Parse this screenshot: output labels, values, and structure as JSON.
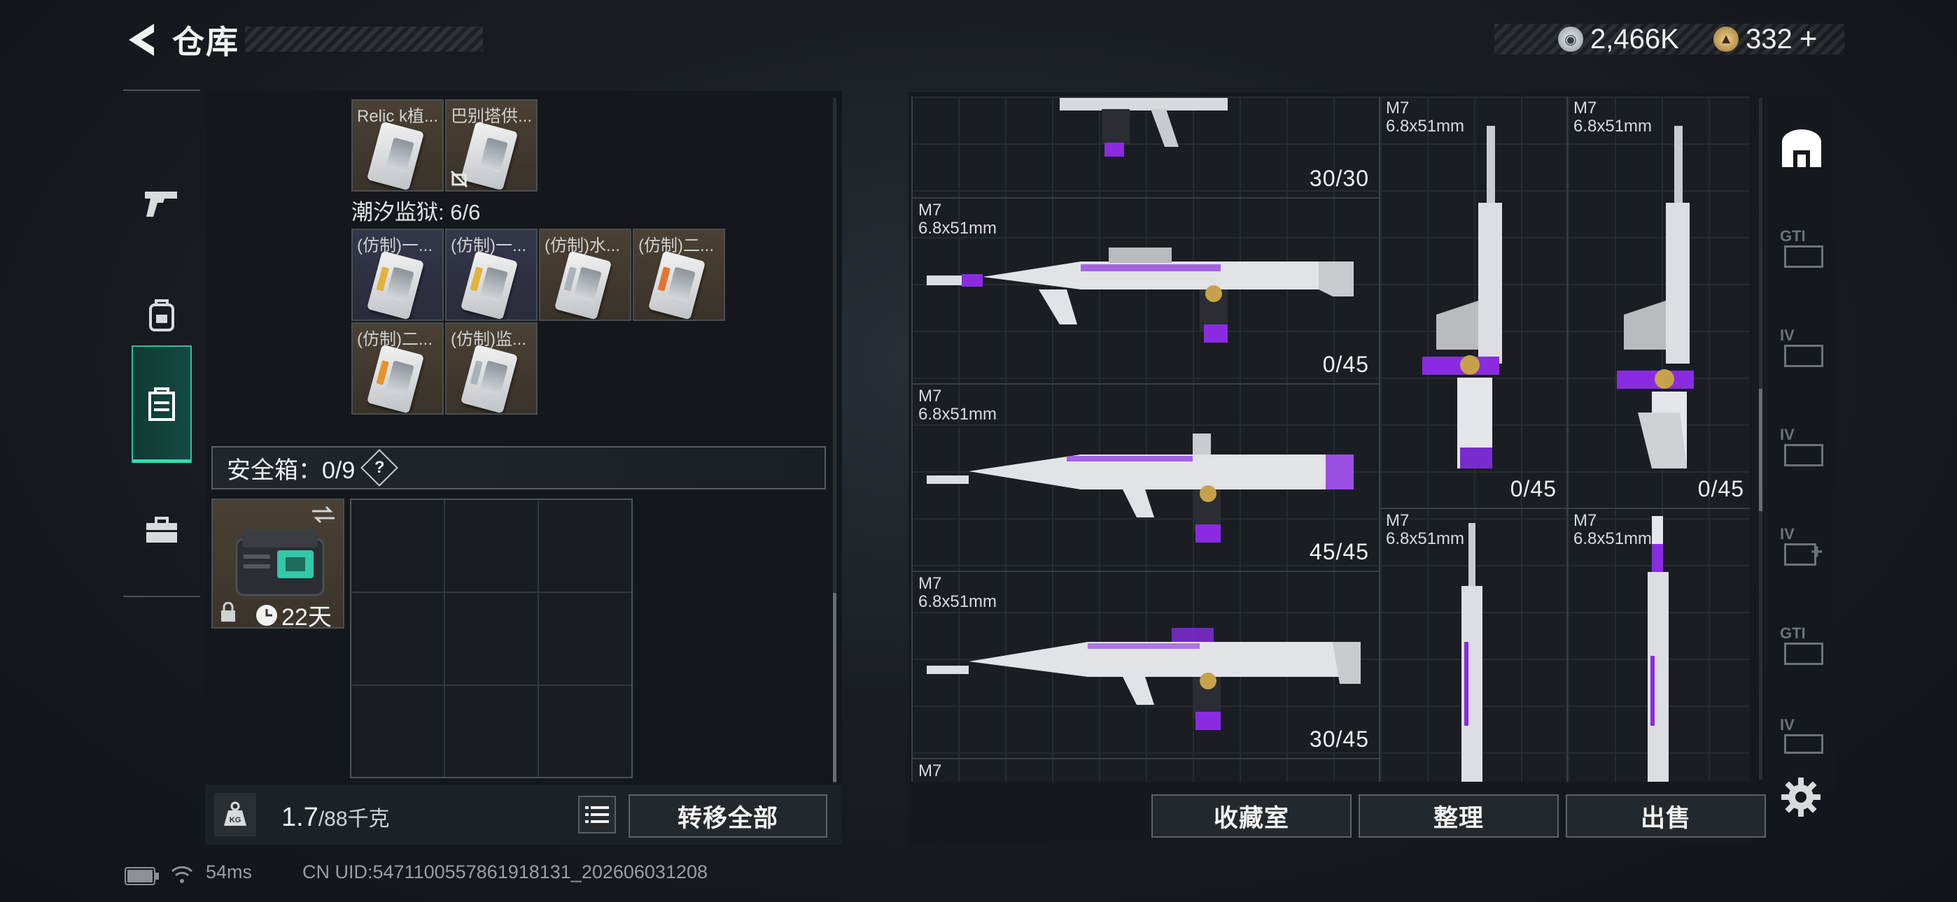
{
  "header": {
    "title": "仓库",
    "back_label": "back"
  },
  "currency": [
    {
      "icon": "silver-coin-icon",
      "value": "2,466K",
      "color": "#c7cbd0"
    },
    {
      "icon": "gold-coin-icon",
      "value": "332",
      "suffix": "+",
      "color": "#c9a35a"
    }
  ],
  "nav": {
    "items": [
      {
        "name": "weapons",
        "icon": "pistol-icon",
        "active": false
      },
      {
        "name": "gear",
        "icon": "backpack-icon",
        "active": false
      },
      {
        "name": "inventory",
        "icon": "storage-icon",
        "active": true
      },
      {
        "name": "toolbox",
        "icon": "toolbox-icon",
        "active": false
      }
    ]
  },
  "stash": {
    "top_row": [
      {
        "label": "Relic k植...",
        "color": "brown"
      },
      {
        "label": "巴别塔供...",
        "color": "brown",
        "badge": "no-trade-icon"
      }
    ],
    "category": {
      "name": "潮汐监狱",
      "count": "6/6"
    },
    "items": [
      {
        "label": "(仿制)一...",
        "color": "navy",
        "strip": "#e2b23a"
      },
      {
        "label": "(仿制)一...",
        "color": "navy",
        "strip": "#e2b23a"
      },
      {
        "label": "(仿制)水...",
        "color": "brown",
        "strip": "#a9b3bb"
      },
      {
        "label": "(仿制)二...",
        "color": "brown",
        "strip": "#e0762f"
      },
      {
        "label": "(仿制)二...",
        "color": "brown",
        "strip": "#e8912d"
      },
      {
        "label": "(仿制)监...",
        "color": "brown",
        "strip": "#a9b3bb"
      }
    ],
    "safe": {
      "label": "安全箱：0/9",
      "help": "?",
      "timer": "22天"
    },
    "weight": {
      "current": "1.7",
      "max": "/88千克"
    },
    "transfer_all": "转移全部"
  },
  "weapons": {
    "cells": [
      {
        "name": "",
        "caliber": "",
        "ammo": "30/30"
      },
      {
        "name": "M7",
        "caliber": "6.8x51mm",
        "ammo": "0/45"
      },
      {
        "name": "M7",
        "caliber": "6.8x51mm",
        "ammo": "45/45"
      },
      {
        "name": "M7",
        "caliber": "6.8x51mm",
        "ammo": "30/45"
      },
      {
        "name": "M7",
        "caliber": "6.8x51mm",
        "ammo": "0/45"
      },
      {
        "name": "M7",
        "caliber": "6.8x51mm",
        "ammo": "0/45"
      },
      {
        "name": "M7",
        "caliber": "6.8x51mm",
        "ammo": ""
      },
      {
        "name": "M7",
        "caliber": "6.8x51mm",
        "ammo": ""
      },
      {
        "name": "M7",
        "caliber": "",
        "ammo": ""
      }
    ],
    "buttons": {
      "collection": "收藏室",
      "sort": "整理",
      "sell": "出售"
    }
  },
  "right_tabs": [
    {
      "icon": "storage-tab-icon",
      "label": ""
    },
    {
      "icon": "gti-tag-icon",
      "label": "GTI"
    },
    {
      "icon": "iv-tag-icon",
      "label": "IV"
    },
    {
      "icon": "iv-tag-icon",
      "label": "IV"
    },
    {
      "icon": "iv-plus-icon",
      "label": "IV"
    },
    {
      "icon": "gti-tag-icon",
      "label": "GTI"
    },
    {
      "icon": "iv-tag-icon",
      "label": "IV"
    }
  ],
  "footer": {
    "ping": "54ms",
    "uid": "CN UID:5471100557861918131_202606031208"
  }
}
